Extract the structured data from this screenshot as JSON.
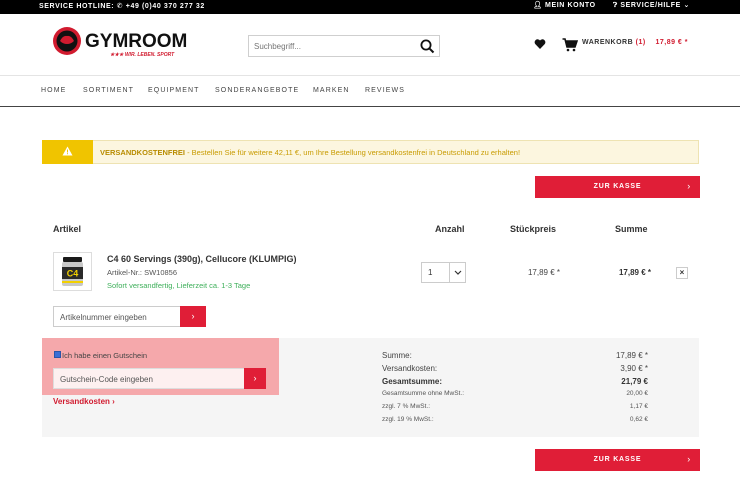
{
  "topbar": {
    "hotline_label": "SERVICE HOTLINE:",
    "hotline_number": "+49 (0)40 370 277 32",
    "account": "MEIN KONTO",
    "service": "SERVICE/HILFE"
  },
  "header": {
    "logo_text": "GYMROOM",
    "logo_slogan": "★★★ WIR. LEBEN. SPORT",
    "search_placeholder": "Suchbegriff...",
    "cart_label": "WARENKORB",
    "cart_count": "(1)",
    "cart_total": "17,89 € *"
  },
  "nav": {
    "items": [
      "HOME",
      "SORTIMENT",
      "EQUIPMENT",
      "SONDERANGEBOTE",
      "MARKEN",
      "REVIEWS"
    ]
  },
  "notice": {
    "title": "VERSANDKOSTENFREI",
    "text": " - Bestellen Sie für weitere 42,11 €, um Ihre Bestellung versandkostenfrei in Deutschland zu erhalten!"
  },
  "checkout_label": "ZUR KASSE",
  "table": {
    "headers": {
      "article": "Artikel",
      "quantity": "Anzahl",
      "unit_price": "Stückpreis",
      "sum": "Summe"
    }
  },
  "product": {
    "name": "C4 60 Servings (390g), Cellucore (KLUMPIG)",
    "sku": "Artikel-Nr.: SW10856",
    "shipping": "Sofort versandfertig, Lieferzeit ca. 1-3 Tage",
    "quantity": "1",
    "unit_price": "17,89 € *",
    "total": "17,89 € *",
    "image_text": "C4"
  },
  "article_number_placeholder": "Artikelnummer eingeben",
  "coupon": {
    "checkbox_label": "Ich habe einen Gutschein",
    "placeholder": "Gutschein-Code eingeben"
  },
  "shipping_link": "Versandkosten",
  "summary": {
    "rows": [
      {
        "label": "Summe:",
        "value": "17,89 € *"
      },
      {
        "label": "Versandkosten:",
        "value": "3,90 € *"
      },
      {
        "label": "Gesamtsumme:",
        "value": "21,79 €"
      },
      {
        "label": "Gesamtsumme ohne MwSt.:",
        "value": "20,00 €"
      },
      {
        "label": "zzgl. 7 % MwSt.:",
        "value": "1,17 €"
      },
      {
        "label": "zzgl. 19 % MwSt.:",
        "value": "0,62 €"
      }
    ]
  },
  "colors": {
    "accent_red": "#e01e37",
    "notice_yellow": "#f0c400",
    "available_green": "#3eaf5a"
  }
}
